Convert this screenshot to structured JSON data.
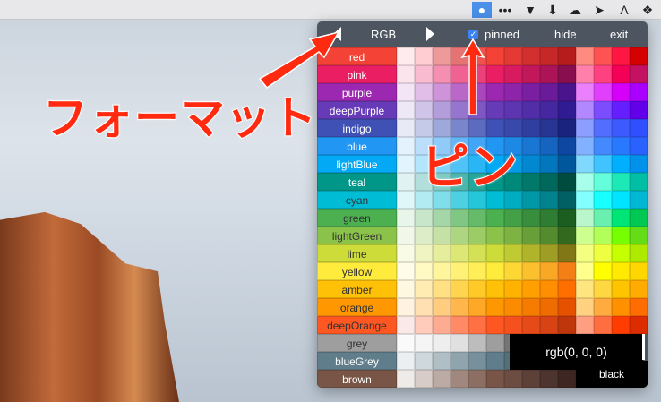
{
  "menubar": {
    "icons": [
      "color-picker-app-icon",
      "more-icon",
      "hat-icon",
      "download-box-icon",
      "cloud-icon",
      "arrow-icon",
      "a-icon",
      "dropbox-icon"
    ]
  },
  "popup": {
    "format_label": "RGB",
    "pinned_label": "pinned",
    "pinned": true,
    "hide_label": "hide",
    "exit_label": "exit",
    "tooltip_value": "rgb(0, 0, 0)",
    "color_name": "black",
    "palette": [
      {
        "name": "red",
        "dark": false,
        "colors": [
          "#FFEBEE",
          "#FFCDD2",
          "#EF9A9A",
          "#E57373",
          "#EF5350",
          "#F44336",
          "#E53935",
          "#D32F2F",
          "#C62828",
          "#B71C1C",
          "#FF8A80",
          "#FF5252",
          "#FF1744",
          "#D50000"
        ]
      },
      {
        "name": "pink",
        "dark": false,
        "colors": [
          "#FCE4EC",
          "#F8BBD0",
          "#F48FB1",
          "#F06292",
          "#EC407A",
          "#E91E63",
          "#D81B60",
          "#C2185B",
          "#AD1457",
          "#880E4F",
          "#FF80AB",
          "#FF4081",
          "#F50057",
          "#C51162"
        ]
      },
      {
        "name": "purple",
        "dark": false,
        "colors": [
          "#F3E5F5",
          "#E1BEE7",
          "#CE93D8",
          "#BA68C8",
          "#AB47BC",
          "#9C27B0",
          "#8E24AA",
          "#7B1FA2",
          "#6A1B9A",
          "#4A148C",
          "#EA80FC",
          "#E040FB",
          "#D500F9",
          "#AA00FF"
        ]
      },
      {
        "name": "deepPurple",
        "dark": false,
        "colors": [
          "#EDE7F6",
          "#D1C4E9",
          "#B39DDB",
          "#9575CD",
          "#7E57C2",
          "#673AB7",
          "#5E35B1",
          "#512DA8",
          "#4527A0",
          "#311B92",
          "#B388FF",
          "#7C4DFF",
          "#651FFF",
          "#6200EA"
        ]
      },
      {
        "name": "indigo",
        "dark": false,
        "colors": [
          "#E8EAF6",
          "#C5CAE9",
          "#9FA8DA",
          "#7986CB",
          "#5C6BC0",
          "#3F51B5",
          "#3949AB",
          "#303F9F",
          "#283593",
          "#1A237E",
          "#8C9EFF",
          "#536DFE",
          "#3D5AFE",
          "#304FFE"
        ]
      },
      {
        "name": "blue",
        "dark": false,
        "colors": [
          "#E3F2FD",
          "#BBDEFB",
          "#90CAF9",
          "#64B5F6",
          "#42A5F5",
          "#2196F3",
          "#1E88E5",
          "#1976D2",
          "#1565C0",
          "#0D47A1",
          "#82B1FF",
          "#448AFF",
          "#2979FF",
          "#2962FF"
        ]
      },
      {
        "name": "lightBlue",
        "dark": false,
        "colors": [
          "#E1F5FE",
          "#B3E5FC",
          "#81D4FA",
          "#4FC3F7",
          "#29B6F6",
          "#03A9F4",
          "#039BE5",
          "#0288D1",
          "#0277BD",
          "#01579B",
          "#80D8FF",
          "#40C4FF",
          "#00B0FF",
          "#0091EA"
        ]
      },
      {
        "name": "teal",
        "dark": false,
        "colors": [
          "#E0F2F1",
          "#B2DFDB",
          "#80CBC4",
          "#4DB6AC",
          "#26A69A",
          "#009688",
          "#00897B",
          "#00796B",
          "#00695C",
          "#004D40",
          "#A7FFEB",
          "#64FFDA",
          "#1DE9B6",
          "#00BFA5"
        ]
      },
      {
        "name": "cyan",
        "dark": true,
        "colors": [
          "#E0F7FA",
          "#B2EBF2",
          "#80DEEA",
          "#4DD0E1",
          "#26C6DA",
          "#00BCD4",
          "#00ACC1",
          "#0097A7",
          "#00838F",
          "#006064",
          "#84FFFF",
          "#18FFFF",
          "#00E5FF",
          "#00B8D4"
        ]
      },
      {
        "name": "green",
        "dark": true,
        "colors": [
          "#E8F5E9",
          "#C8E6C9",
          "#A5D6A7",
          "#81C784",
          "#66BB6A",
          "#4CAF50",
          "#43A047",
          "#388E3C",
          "#2E7D32",
          "#1B5E20",
          "#B9F6CA",
          "#69F0AE",
          "#00E676",
          "#00C853"
        ]
      },
      {
        "name": "lightGreen",
        "dark": true,
        "colors": [
          "#F1F8E9",
          "#DCEDC8",
          "#C5E1A5",
          "#AED581",
          "#9CCC65",
          "#8BC34A",
          "#7CB342",
          "#689F38",
          "#558B2F",
          "#33691E",
          "#CCFF90",
          "#B2FF59",
          "#76FF03",
          "#64DD17"
        ]
      },
      {
        "name": "lime",
        "dark": true,
        "colors": [
          "#F9FBE7",
          "#F0F4C3",
          "#E6EE9C",
          "#DCE775",
          "#D4E157",
          "#CDDC39",
          "#C0CA33",
          "#AFB42B",
          "#9E9D24",
          "#827717",
          "#F4FF81",
          "#EEFF41",
          "#C6FF00",
          "#AEEA00"
        ]
      },
      {
        "name": "yellow",
        "dark": true,
        "colors": [
          "#FFFDE7",
          "#FFF9C4",
          "#FFF59D",
          "#FFF176",
          "#FFEE58",
          "#FFEB3B",
          "#FDD835",
          "#FBC02D",
          "#F9A825",
          "#F57F17",
          "#FFFF8D",
          "#FFFF00",
          "#FFEA00",
          "#FFD600"
        ]
      },
      {
        "name": "amber",
        "dark": true,
        "colors": [
          "#FFF8E1",
          "#FFECB3",
          "#FFE082",
          "#FFD54F",
          "#FFCA28",
          "#FFC107",
          "#FFB300",
          "#FFA000",
          "#FF8F00",
          "#FF6F00",
          "#FFE57F",
          "#FFD740",
          "#FFC400",
          "#FFAB00"
        ]
      },
      {
        "name": "orange",
        "dark": true,
        "colors": [
          "#FFF3E0",
          "#FFE0B2",
          "#FFCC80",
          "#FFB74D",
          "#FFA726",
          "#FF9800",
          "#FB8C00",
          "#F57C00",
          "#EF6C00",
          "#E65100",
          "#FFD180",
          "#FFAB40",
          "#FF9100",
          "#FF6D00"
        ]
      },
      {
        "name": "deepOrange",
        "dark": true,
        "colors": [
          "#FBE9E7",
          "#FFCCBC",
          "#FFAB91",
          "#FF8A65",
          "#FF7043",
          "#FF5722",
          "#F4511E",
          "#E64A19",
          "#D84315",
          "#BF360C",
          "#FF9E80",
          "#FF6E40",
          "#FF3D00",
          "#DD2C00"
        ]
      },
      {
        "name": "grey",
        "dark": true,
        "colors": [
          "#FAFAFA",
          "#F5F5F5",
          "#EEEEEE",
          "#E0E0E0",
          "#BDBDBD",
          "#9E9E9E",
          "#757575",
          "#616161",
          "#424242",
          "#212121"
        ]
      },
      {
        "name": "blueGrey",
        "dark": false,
        "colors": [
          "#ECEFF1",
          "#CFD8DC",
          "#B0BEC5",
          "#90A4AE",
          "#78909C",
          "#607D8B",
          "#546E7A",
          "#455A64",
          "#37474F",
          "#263238"
        ]
      },
      {
        "name": "brown",
        "dark": false,
        "colors": [
          "#EFEBE9",
          "#D7CCC8",
          "#BCAAA4",
          "#A1887F",
          "#8D6E63",
          "#795548",
          "#6D4C41",
          "#5D4037",
          "#4E342E",
          "#3E2723"
        ]
      }
    ]
  },
  "annotations": {
    "format": "フォーマット",
    "pin": "ピン",
    "color": "#ff2a10"
  }
}
